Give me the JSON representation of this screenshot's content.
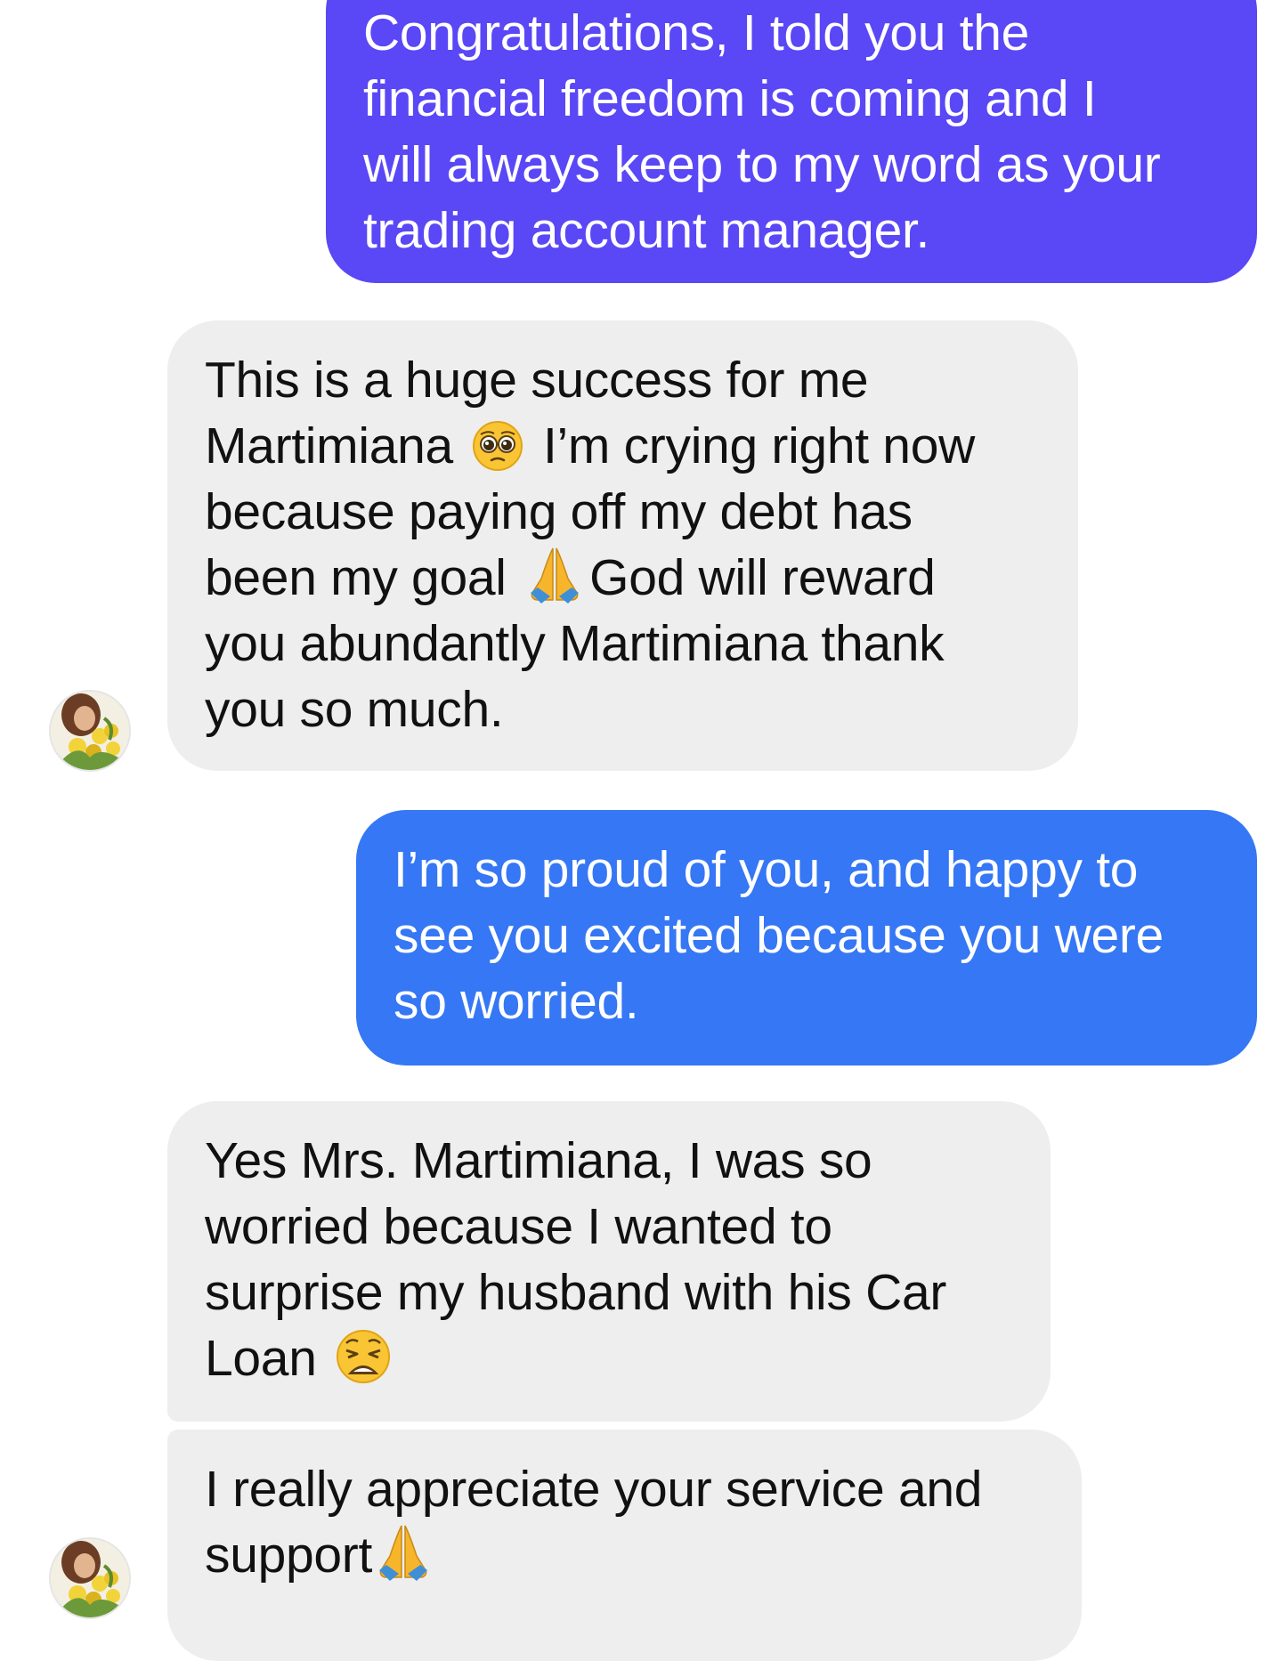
{
  "conversation": {
    "messages": [
      {
        "direction": "sent",
        "lines": [
          "Congratulations, I told you the",
          "financial freedom is coming and I",
          "will always keep to my word as your",
          "trading account manager."
        ]
      },
      {
        "direction": "received",
        "line1": "This is a huge success for me",
        "line2_before": "Martimiana ",
        "line2_emoji": "pleading-face-emoji",
        "line2_after": " I’m crying right now",
        "line3": "because paying off my debt has",
        "line4_before": "been my goal ",
        "line4_emoji": "folded-hands-emoji",
        "line4_after": "God will reward",
        "line5": "you abundantly Martimiana thank",
        "line6": "you so much."
      },
      {
        "direction": "sent",
        "lines": [
          "I’m so proud of you, and happy to",
          "see you excited because you were",
          "so worried."
        ]
      },
      {
        "direction": "received",
        "line1": "Yes Mrs. Martimiana, I was so",
        "line2": "worried because I wanted to",
        "line3": "surprise my husband with his Car",
        "line4_before": "Loan ",
        "line4_emoji": "weary-face-emoji"
      },
      {
        "direction": "received",
        "line1": "I really appreciate your service and",
        "line2_before": "support",
        "line2_emoji": "folded-hands-emoji"
      }
    ]
  },
  "colors": {
    "sent_bubble_top": "#5a47f5",
    "sent_bubble_bottom": "#3577f4",
    "received_bubble": "#eeeeee",
    "background": "#ffffff"
  }
}
